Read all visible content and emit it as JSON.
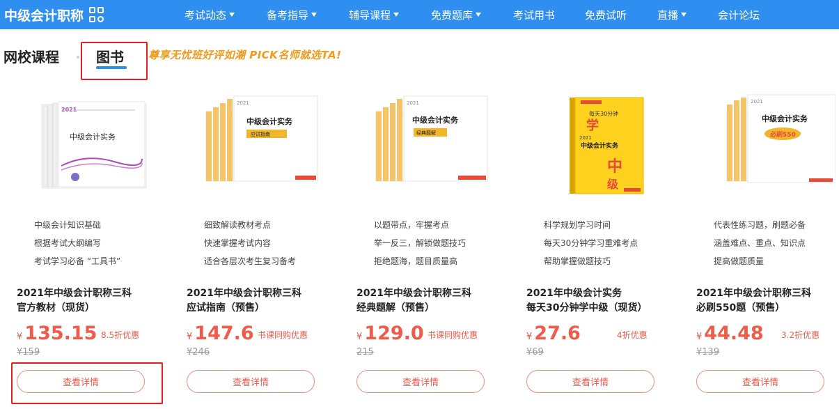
{
  "brand": {
    "title": "中级会计职称",
    "menu_icon": "grid-menu-icon"
  },
  "nav": [
    {
      "label": "考试动态",
      "has_dropdown": true
    },
    {
      "label": "备考指导",
      "has_dropdown": true
    },
    {
      "label": "辅导课程",
      "has_dropdown": true
    },
    {
      "label": "免费题库",
      "has_dropdown": true
    },
    {
      "label": "考试用书",
      "has_dropdown": false
    },
    {
      "label": "免费试听",
      "has_dropdown": false
    },
    {
      "label": "直播",
      "has_dropdown": true
    },
    {
      "label": "会计论坛",
      "has_dropdown": false
    }
  ],
  "section": {
    "tab_online": "网校课程",
    "tab_books": "图书",
    "promo": "尊享无忧班好评如潮 PICK名师就选TA!"
  },
  "colors": {
    "nav_bg": "#2e8ff0",
    "accent_red": "#f05b4a",
    "promo_orange": "#f19a1b",
    "highlight_box": "#e02020"
  },
  "products": [
    {
      "features": [
        "中级会计知识基础",
        "根据考试大纲编写",
        "考试学习必备 “工具书”"
      ],
      "title_line1": "2021年中级会计职称三科",
      "title_line2": "官方教材（现货）",
      "currency": "¥",
      "price": "135.15",
      "discount": "8.5折优惠",
      "original_price": "¥159",
      "button": "查看详情",
      "cover_title": "中级会计实务",
      "cover_year": "2021"
    },
    {
      "features": [
        "细致解读教材考点",
        "快速掌握考试内容",
        "适合各层次考生复习备考"
      ],
      "title_line1": "2021年中级会计职称三科",
      "title_line2": "应试指南（预售）",
      "currency": "¥",
      "price": "147.6",
      "discount": "书课同购优惠",
      "original_price": "¥246",
      "button": "查看详情",
      "cover_title": "中级会计实务",
      "cover_year": "2021"
    },
    {
      "features": [
        "以题带点，牢握考点",
        "举一反三，解锁做题技巧",
        "拒绝题海，题目质量高"
      ],
      "title_line1": "2021年中级会计职称三科",
      "title_line2": "经典题解（预售）",
      "currency": "¥",
      "price": "129.0",
      "discount": "书课同购优惠",
      "original_price": "215",
      "button": "查看详情",
      "cover_title": "中级会计实务",
      "cover_year": "2021"
    },
    {
      "features": [
        "科学规划学习时间",
        "每天30分钟学习重难考点",
        "帮助掌握做题技巧"
      ],
      "title_line1": "2021年中级会计实务",
      "title_line2": "每天30分钟学中级（现货）",
      "currency": "¥",
      "price": "27.6",
      "discount": "4折优惠",
      "original_price": "¥69",
      "button": "查看详情",
      "cover_title": "中级会计实务",
      "cover_year": "2021"
    },
    {
      "features": [
        "代表性练习题，刷题必备",
        "涵盖难点、重点、知识点",
        "提高做题质量"
      ],
      "title_line1": "2021年中级会计职称三科",
      "title_line2": "必刷550题（预售）",
      "currency": "¥",
      "price": "44.48",
      "discount": "3.2折优惠",
      "original_price": "¥139",
      "button": "查看详情",
      "cover_title": "中级会计实务",
      "cover_year": "2021"
    }
  ]
}
